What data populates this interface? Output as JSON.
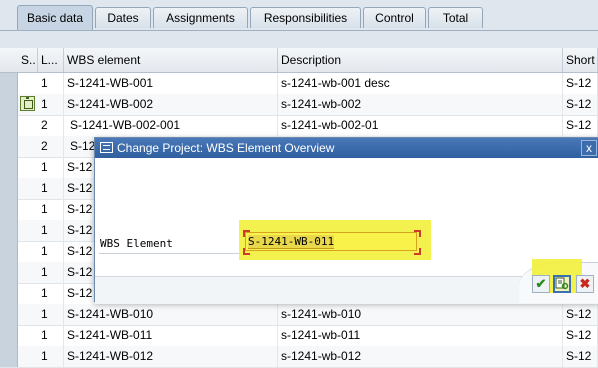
{
  "tabs": [
    "Basic data",
    "Dates",
    "Assignments",
    "Responsibilities",
    "Control",
    "Total"
  ],
  "columns": [
    "S..",
    "L...",
    "WBS element",
    "Description",
    "Short"
  ],
  "rows": [
    {
      "level": "1",
      "wbs": "S-1241-WB-001",
      "desc": "s-1241-wb-001 desc",
      "short": "S-12"
    },
    {
      "level": "1",
      "wbs": "S-1241-WB-002",
      "desc": "s-1241-wb-002",
      "short": "S-12"
    },
    {
      "level": "2",
      "wbs": "S-1241-WB-002-001",
      "desc": "s-1241-wb-002-01",
      "short": "S-12"
    },
    {
      "level": "2",
      "wbs": "S-12",
      "desc": "",
      "short": ""
    },
    {
      "level": "1",
      "wbs": "S-12",
      "desc": "",
      "short": ""
    },
    {
      "level": "1",
      "wbs": "S-12",
      "desc": "",
      "short": ""
    },
    {
      "level": "1",
      "wbs": "S-12",
      "desc": "",
      "short": ""
    },
    {
      "level": "1",
      "wbs": "S-12",
      "desc": "",
      "short": ""
    },
    {
      "level": "1",
      "wbs": "S-12",
      "desc": "",
      "short": ""
    },
    {
      "level": "1",
      "wbs": "S-12",
      "desc": "",
      "short": ""
    },
    {
      "level": "1",
      "wbs": "S-12",
      "desc": "",
      "short": ""
    },
    {
      "level": "1",
      "wbs": "S-1241-WB-010",
      "desc": "s-1241-wb-010",
      "short": "S-12"
    },
    {
      "level": "1",
      "wbs": "S-1241-WB-011",
      "desc": "s-1241-wb-011",
      "short": "S-12"
    },
    {
      "level": "1",
      "wbs": "S-1241-WB-012",
      "desc": "s-1241-wb-012",
      "short": "S-12"
    }
  ],
  "dialog": {
    "title": "Change Project: WBS Element Overview",
    "close": "x",
    "field_label": "WBS Element",
    "field_value": "S-1241-WB-011"
  },
  "icons": {
    "row_selected": "tree-node-icon",
    "dialog": "window-icon",
    "confirm": "check-icon",
    "find": "find-icon",
    "cancel": "cancel-icon"
  },
  "colors": {
    "title_bar": "#2f5f9f",
    "highlight": "#f2ef3a",
    "confirm": "#2d8a1e",
    "cancel": "#c8281d"
  }
}
